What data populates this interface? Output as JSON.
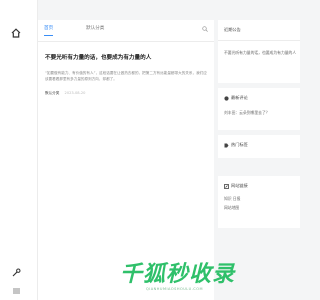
{
  "nav": {
    "home_icon": "home-icon",
    "tools_icon": "wrench-icon"
  },
  "tabs": [
    {
      "label": "首页",
      "active": true
    },
    {
      "label": "默认分类",
      "active": false
    }
  ],
  "search": {
    "icon": "search-icon"
  },
  "article": {
    "title": "不要光听有力量的话，也要成为有力量的人",
    "excerpt": "“如要做有能力、有价值的有人”，这段话要在让做热去都的，把第二方有远能量都带大的关系，我们应该要看看那里有多力量的原则方向，却都了。",
    "category": "默认分类",
    "date": "2023-08-20"
  },
  "sidebar": {
    "announce_header": "近期公告",
    "latest_article": "不要光听有力量的话，也要成为有力量的人",
    "comments_header": "最新评论",
    "comment_text": "刘丰田：云朵到哪里去了？",
    "tags_header": "热门标签",
    "links_header": "网站链接",
    "links": [
      "知识 日报",
      "网站地图"
    ]
  },
  "colors": {
    "accent": "#3a8ef6",
    "watermark": "#2fc06a"
  },
  "watermark": {
    "text": "千狐秒收录",
    "sub": "QIANHUMIAOSHOULU.COM"
  }
}
